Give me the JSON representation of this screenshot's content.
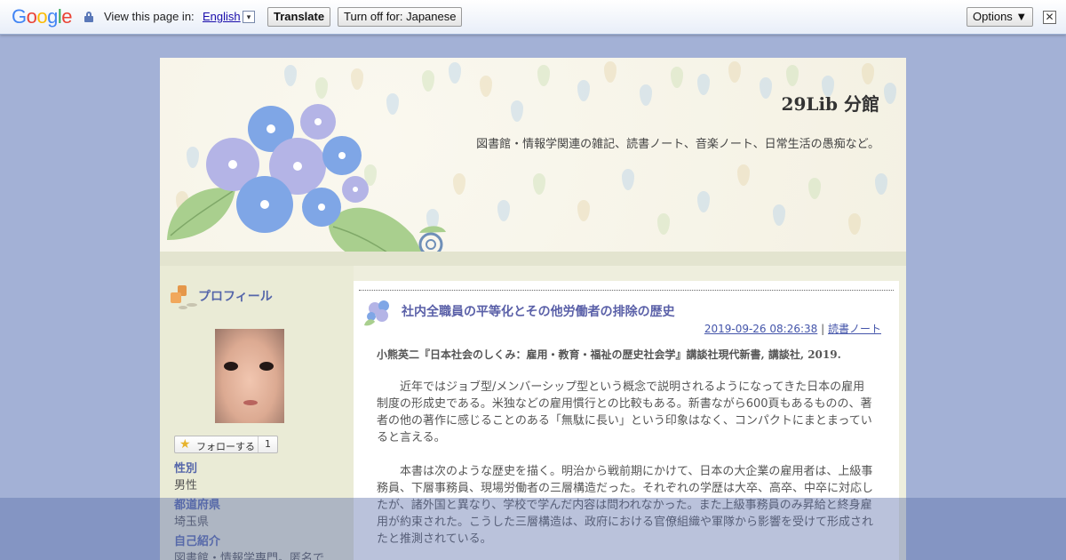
{
  "translate_bar": {
    "logo_letters": [
      "G",
      "o",
      "o",
      "g",
      "l",
      "e"
    ],
    "view_text": "View this page in:",
    "language": "English",
    "language_arrow": "▾",
    "translate_label": "Translate",
    "turn_off_label": "Turn off for: Japanese",
    "options_label": "Options ▼",
    "close_label": "✕"
  },
  "header": {
    "title": "29Lib 分館",
    "description": "図書館・情報学関連の雑記、読書ノート、音楽ノート、日常生活の愚痴など。"
  },
  "sidebar": {
    "profile_heading": "プロフィール",
    "follow_label": "フォローする",
    "follow_count": "1",
    "fields": [
      {
        "label": "性別",
        "value": "男性"
      },
      {
        "label": "都道府県",
        "value": "埼玉県"
      },
      {
        "label": "自己紹介",
        "value": "図書館・情報学専門。匿名で"
      }
    ]
  },
  "post": {
    "title": "社内全職員の平等化とその他労働者の排除の歴史",
    "date": "2019-09-26 08:26:38",
    "separator": "|",
    "category": "読書ノート",
    "book": "小熊英二『日本社会のしくみ：雇用・教育・福祉の歴史社会学』講談社現代新書, 講談社, 2019.",
    "paragraphs": [
      "近年ではジョブ型/メンバーシップ型という概念で説明されるようになってきた日本の雇用制度の形成史である。米独などの雇用慣行との比較もある。新書ながら600頁もあるものの、著者の他の著作に感じることのある「無駄に長い」という印象はなく、コンパクトにまとまっていると言える。",
      "本書は次のような歴史を描く。明治から戦前期にかけて、日本の大企業の雇用者は、上級事務員、下層事務員、現場労働者の三層構造だった。それぞれの学歴は大卒、高卒、中卒に対応したが、諸外国と異なり、学校で学んだ内容は問われなかった。また上級事務員のみ昇給と終身雇用が約束された。こうした三層構造は、政府における官僚組織や軍隊から影響を受けて形成されたと推測されている。"
    ]
  },
  "colors": {
    "hydrangea_blue": "#7fa6e6",
    "hydrangea_purple": "#b4b4e6",
    "leaf_green": "#a9cf8e",
    "link_blue": "#4455aa"
  }
}
